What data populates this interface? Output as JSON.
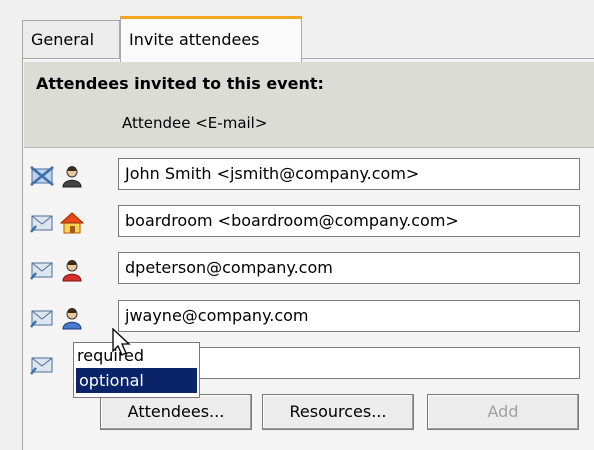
{
  "tabs": [
    {
      "label": "General"
    },
    {
      "label": "Invite attendees"
    }
  ],
  "section_title": "Attendees invited to this event:",
  "column_header": "Attendee <E-mail>",
  "attendees": [
    {
      "value": "John Smith <jsmith@company.com>",
      "mail_state": "declined",
      "type": "person"
    },
    {
      "value": "boardroom <boardroom@company.com>",
      "mail_state": "sent",
      "type": "resource"
    },
    {
      "value": "dpeterson@company.com",
      "mail_state": "sent",
      "type": "person-required"
    },
    {
      "value": "jwayne@company.com",
      "mail_state": "sent",
      "type": "person-optional"
    },
    {
      "value": "",
      "mail_state": "sent",
      "type": "none"
    }
  ],
  "role_dropdown": {
    "options": [
      "required",
      "optional"
    ],
    "selected": "optional"
  },
  "buttons": {
    "attendees": "Attendees...",
    "resources": "Resources...",
    "add": "Add"
  },
  "colors": {
    "tab_accent": "#f5a623",
    "selection": "#0a246a"
  }
}
